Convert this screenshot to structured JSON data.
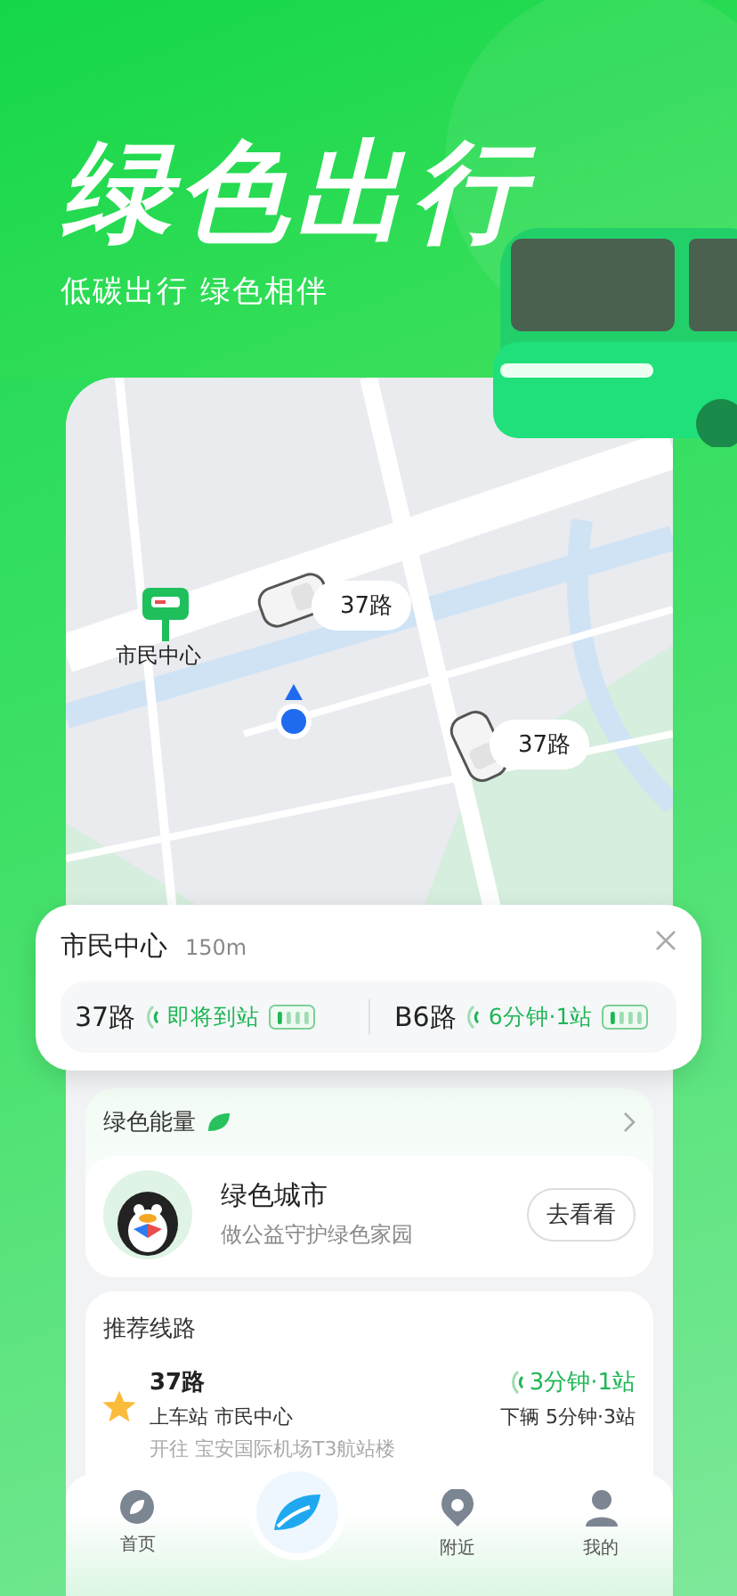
{
  "hero": {
    "title": "绿色出行",
    "subtitle": "低碳出行 绿色相伴"
  },
  "map": {
    "stop_label": "市民中心",
    "buses": [
      {
        "label": "37路"
      },
      {
        "label": "37路"
      }
    ]
  },
  "stop_card": {
    "name": "市民中心",
    "distance": "150m",
    "arrivals": [
      {
        "route": "37路",
        "status": "即将到站"
      },
      {
        "route": "B6路",
        "status": "6分钟·1站"
      }
    ]
  },
  "energy": {
    "title": "绿色能量",
    "card": {
      "title": "绿色城市",
      "subtitle": "做公益守护绿色家园",
      "button": "去看看"
    }
  },
  "recommended": {
    "title": "推荐线路",
    "routes": [
      {
        "route": "37路",
        "starred": true,
        "boarding": "上车站 市民中心",
        "direction": "开往 宝安国际机场T3航站楼",
        "eta": "3分钟·1站",
        "alight": "下辆 5分钟·3站"
      }
    ]
  },
  "tab_bar": [
    {
      "kind": "home",
      "label": "首页"
    },
    {
      "kind": "leaf"
    },
    {
      "kind": "nearby",
      "label": "附近"
    },
    {
      "kind": "profile",
      "label": "我的"
    }
  ]
}
